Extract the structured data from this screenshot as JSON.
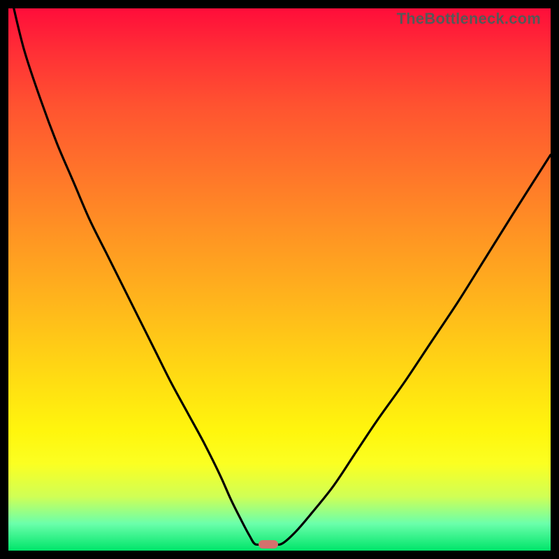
{
  "source": {
    "credit_text": "TheBottleneck.com"
  },
  "colors": {
    "gradient_top": "#ff0d3a",
    "gradient_mid": "#ffd614",
    "gradient_bottom": "#00e56a",
    "curve": "#000000",
    "marker": "#d4716d",
    "frame": "#000000"
  },
  "chart_data": {
    "type": "line",
    "title": "",
    "xlabel": "",
    "ylabel": "",
    "xlim": [
      0,
      100
    ],
    "ylim": [
      0,
      100
    ],
    "legend": false,
    "annotations": [],
    "grid": false,
    "series": [
      {
        "name": "left-branch",
        "x": [
          1,
          3,
          6,
          9,
          12,
          15,
          18,
          21,
          24,
          27,
          30,
          33,
          36,
          39,
          41,
          43,
          44.5,
          45.5
        ],
        "y": [
          100,
          92,
          83,
          75,
          68,
          61,
          55,
          49,
          43,
          37,
          31,
          25.5,
          20,
          14,
          9.5,
          5.5,
          2.7,
          1.2
        ]
      },
      {
        "name": "flat-valley",
        "x": [
          45.5,
          47,
          49,
          50.5
        ],
        "y": [
          1.2,
          1.2,
          1.2,
          1.3
        ]
      },
      {
        "name": "right-branch",
        "x": [
          50.5,
          53,
          56,
          60,
          64,
          68,
          73,
          78,
          83,
          88,
          93,
          100
        ],
        "y": [
          1.3,
          3.5,
          7,
          12,
          18,
          24,
          31,
          38.5,
          46,
          54,
          62,
          73
        ]
      }
    ],
    "minimum_marker": {
      "x": 48,
      "y": 1.2
    }
  }
}
